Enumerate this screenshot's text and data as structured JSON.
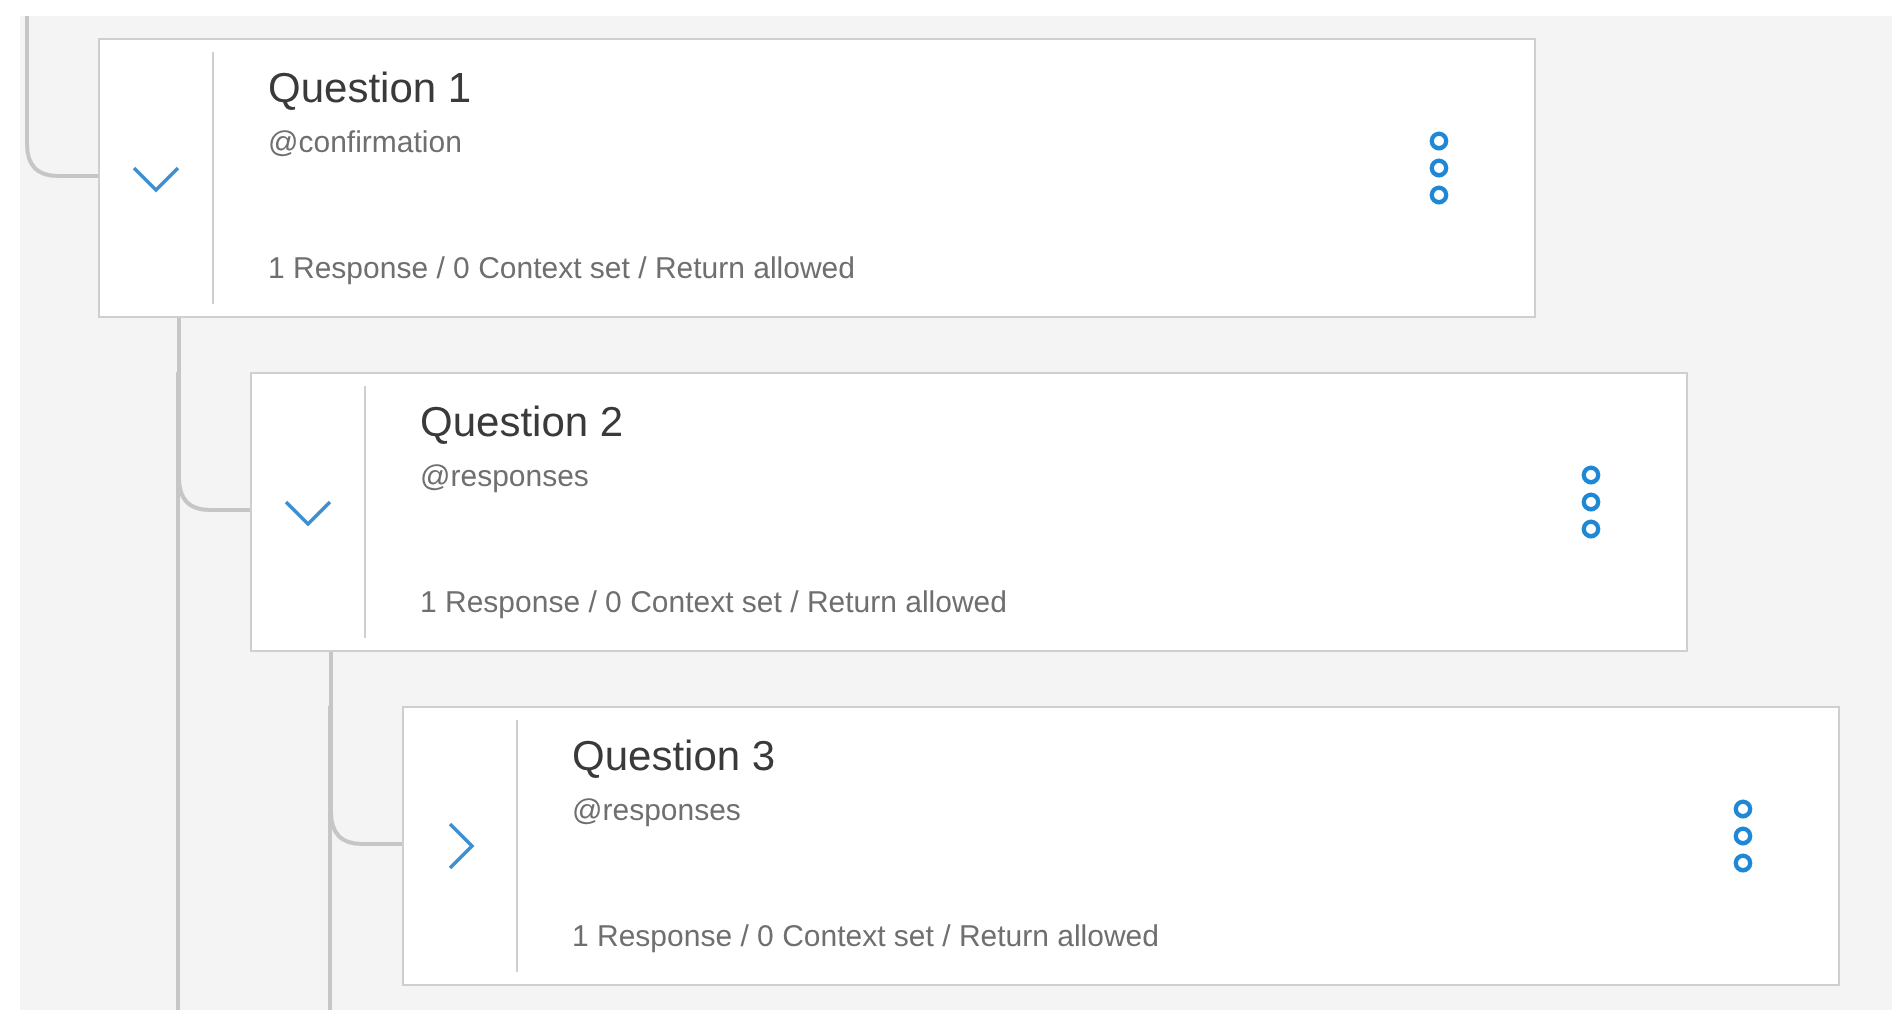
{
  "nodes": [
    {
      "title": "Question 1",
      "condition": "@confirmation",
      "summary": "1 Response / 0 Context set / Return allowed",
      "expanded": true,
      "children": [
        {
          "title": "Question 2",
          "condition": "@responses",
          "summary": "1 Response / 0 Context set / Return allowed",
          "expanded": true,
          "children": [
            {
              "title": "Question 3",
              "condition": "@responses",
              "summary": "1 Response / 0 Context set / Return allowed",
              "expanded": false
            }
          ]
        }
      ]
    }
  ]
}
